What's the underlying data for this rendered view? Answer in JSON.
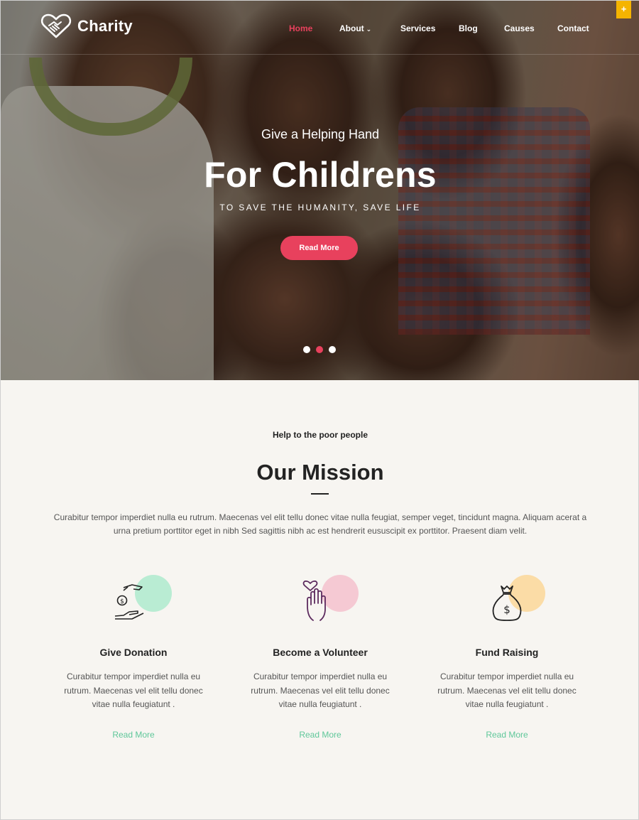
{
  "brand": {
    "name": "Charity",
    "logo_icon": "heart-handshake-icon"
  },
  "nav": {
    "items": [
      {
        "label": "Home",
        "active": true
      },
      {
        "label": "About",
        "has_dropdown": true
      },
      {
        "label": "Services"
      },
      {
        "label": "Blog"
      },
      {
        "label": "Causes"
      },
      {
        "label": "Contact"
      }
    ],
    "corner_button": "+"
  },
  "hero": {
    "subtitle": "Give a Helping Hand",
    "title": "For Childrens",
    "tagline": "TO SAVE THE HUMANITY, SAVE LIFE",
    "button": "Read More",
    "slides": 3,
    "active_slide": 2
  },
  "mission": {
    "eyebrow": "Help to the poor people",
    "title": "Our Mission",
    "text": "Curabitur tempor imperdiet nulla eu rutrum. Maecenas vel elit tellu donec vitae nulla feugiat, semper veget, tincidunt magna. Aliquam acerat a urna pretium porttitor eget in nibh Sed sagittis nibh ac est hendrerit eususcipit ex porttitor. Praesent diam velit.",
    "cards": [
      {
        "icon": "donation-hand-coin-icon",
        "accent": "#b9ecd3",
        "title": "Give Donation",
        "text": "Curabitur tempor imperdiet nulla eu rutrum. Maecenas vel elit tellu donec vitae nulla feugiatunt .",
        "link": "Read More"
      },
      {
        "icon": "volunteer-hand-heart-icon",
        "accent": "#f5c9d3",
        "title": "Become a Volunteer",
        "text": "Curabitur tempor imperdiet nulla eu rutrum. Maecenas vel elit tellu donec vitae nulla feugiatunt .",
        "link": "Read More"
      },
      {
        "icon": "money-bag-icon",
        "accent": "#fbdca6",
        "title": "Fund Raising",
        "text": "Curabitur tempor imperdiet nulla eu rutrum. Maecenas vel elit tellu donec vitae nulla feugiatunt .",
        "link": "Read More"
      }
    ]
  },
  "colors": {
    "accent": "#e8415d",
    "link": "#5fc79a",
    "corner": "#f5b400"
  }
}
